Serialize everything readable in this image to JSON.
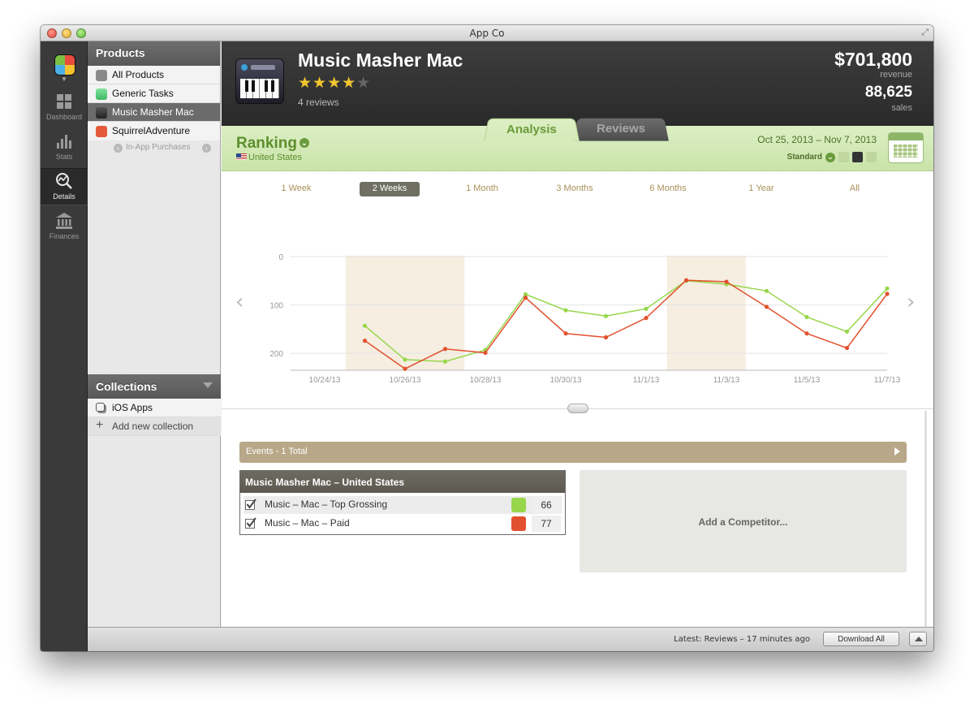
{
  "window": {
    "title": "App Co"
  },
  "nav": [
    {
      "label": "Dashboard",
      "icon": "dashboard-icon"
    },
    {
      "label": "Stats",
      "icon": "bar-chart-icon"
    },
    {
      "label": "Details",
      "icon": "chart-magnifier-icon"
    },
    {
      "label": "Finances",
      "icon": "bank-icon"
    }
  ],
  "sidebar": {
    "products_header": "Products",
    "items": [
      {
        "label": "All Products",
        "color": "#8a8a8a"
      },
      {
        "label": "Generic Tasks",
        "color": "#5fcf80"
      },
      {
        "label": "Music Masher Mac",
        "color": "#3a3a4a"
      },
      {
        "label": "SquirrelAdventure",
        "color": "#e25a3b"
      }
    ],
    "sub_item": "In-App Purchases",
    "collections_header": "Collections",
    "collections": [
      {
        "label": "iOS Apps"
      },
      {
        "label": "Add new collection"
      }
    ]
  },
  "product": {
    "name": "Music Masher Mac",
    "stars_on": "★★★★",
    "stars_off": "★",
    "reviews": "4 reviews",
    "revenue": "$701,800",
    "revenue_label": "revenue",
    "sales": "88,625",
    "sales_label": "sales"
  },
  "tabs": {
    "analysis": "Analysis",
    "reviews": "Reviews"
  },
  "ranking": {
    "title": "Ranking",
    "country": "United States",
    "date_range": "Oct 25, 2013 – Nov 7, 2013",
    "mode": "Standard"
  },
  "ranges": [
    "1 Week",
    "2 Weeks",
    "1 Month",
    "3 Months",
    "6 Months",
    "1 Year",
    "All"
  ],
  "chart_data": {
    "type": "line",
    "x": [
      "10/24/13",
      "10/25/13",
      "10/26/13",
      "10/27/13",
      "10/28/13",
      "10/29/13",
      "10/30/13",
      "10/31/13",
      "11/1/13",
      "11/2/13",
      "11/3/13",
      "11/4/13",
      "11/5/13",
      "11/6/13",
      "11/7/13"
    ],
    "x_tick_labels": [
      "10/24/13",
      "10/26/13",
      "10/28/13",
      "10/30/13",
      "11/1/13",
      "11/3/13",
      "11/5/13",
      "11/7/13"
    ],
    "y_ticks": [
      0,
      100,
      200
    ],
    "ylim": [
      0,
      235
    ],
    "y_inverted": true,
    "grid": true,
    "highlight_ranges": [
      [
        "10/25/13",
        "10/27/13"
      ],
      [
        "11/2/13",
        "11/3/13"
      ]
    ],
    "series": [
      {
        "color": "#97d64a",
        "values": [
          null,
          143,
          213,
          217,
          193,
          78,
          111,
          123,
          108,
          50,
          57,
          71,
          125,
          155,
          66
        ]
      },
      {
        "color": "#e2512f",
        "values": [
          null,
          174,
          232,
          191,
          199,
          85,
          159,
          167,
          127,
          49,
          52,
          104,
          159,
          189,
          77
        ]
      }
    ]
  },
  "events": {
    "label": "Events - 1 Total"
  },
  "series_box": {
    "title": "Music Masher Mac – United States",
    "rows": [
      {
        "label": "Music – Mac – Top Grossing",
        "value": "66",
        "color": "#97d64a"
      },
      {
        "label": "Music – Mac – Paid",
        "value": "77",
        "color": "#e2512f"
      }
    ]
  },
  "competitor": {
    "label": "Add a Competitor..."
  },
  "status": {
    "latest": "Latest: Reviews – 17 minutes ago",
    "download": "Download All"
  }
}
